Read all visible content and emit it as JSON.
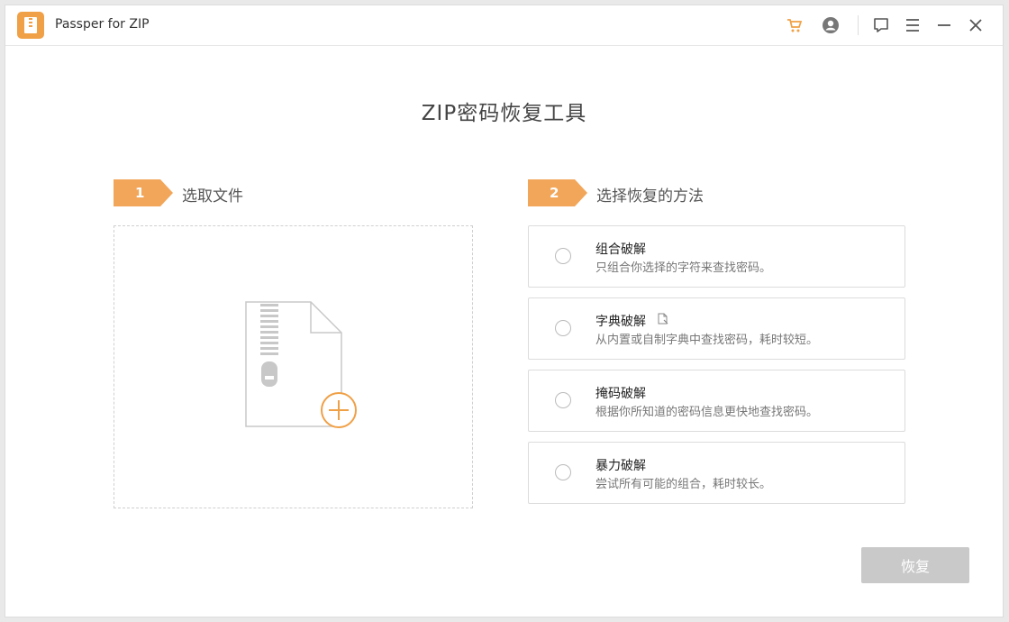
{
  "app": {
    "title": "Passper for ZIP"
  },
  "titlebar": {
    "icons": [
      "cart-icon",
      "account-icon",
      "feedback-icon",
      "menu-icon",
      "minimize-icon",
      "close-icon"
    ]
  },
  "main": {
    "title": "ZIP密码恢复工具",
    "step1": {
      "number": "1",
      "label": "选取文件"
    },
    "step2": {
      "number": "2",
      "label": "选择恢复的方法"
    },
    "options": [
      {
        "title": "组合破解",
        "desc": "只组合你选择的字符来查找密码。"
      },
      {
        "title": "字典破解",
        "desc": "从内置或自制字典中查找密码，耗时较短。"
      },
      {
        "title": "掩码破解",
        "desc": "根据你所知道的密码信息更快地查找密码。"
      },
      {
        "title": "暴力破解",
        "desc": "尝试所有可能的组合，耗时较长。"
      }
    ],
    "recover_label": "恢复"
  },
  "colors": {
    "accent": "#f2a65a",
    "disabled_button": "#c9c9c9"
  }
}
